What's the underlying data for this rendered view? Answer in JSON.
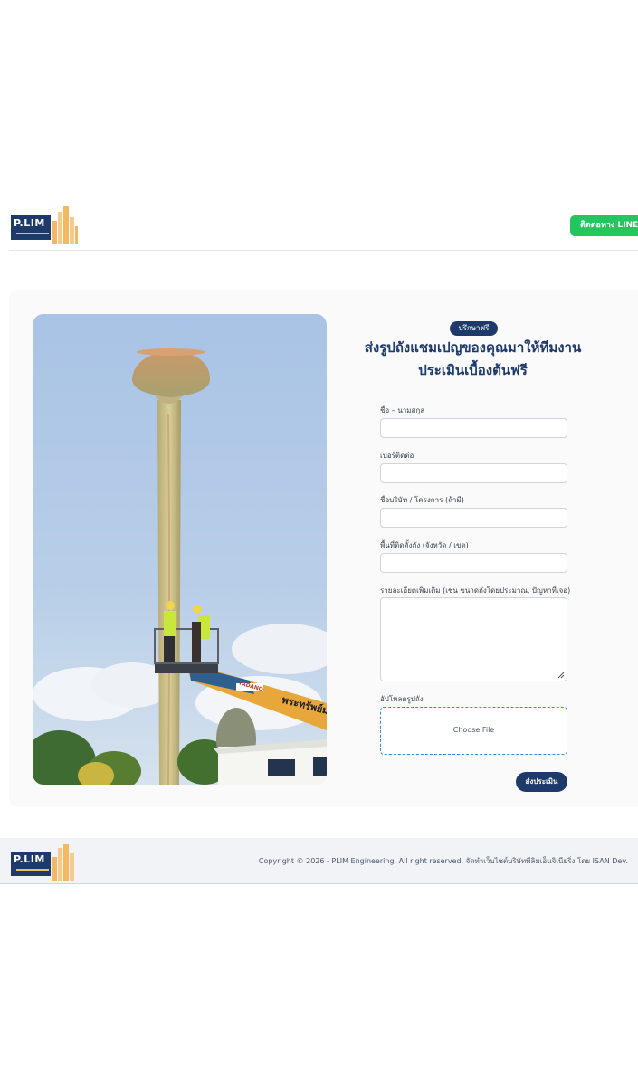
{
  "brand": {
    "logo_text": "P.LIM"
  },
  "header": {
    "line_button_label": "ติดต่อทาง LINE"
  },
  "form": {
    "badge": "ปรึกษาฟรี",
    "title_line1": "ส่งรูปถังแชมเปญของคุณมาให้ทีมงาน",
    "title_line2": "ประเมินเบื้องต้นฟรี",
    "fields": [
      {
        "label": "ชื่อ – นามสกุล",
        "value": ""
      },
      {
        "label": "เบอร์ติดต่อ",
        "value": ""
      },
      {
        "label": "ชื่อบริษัท / โครงการ (ถ้ามี)",
        "value": ""
      },
      {
        "label": "พื้นที่ติดตั้งถัง (จังหวัด / เขต)",
        "value": ""
      }
    ],
    "details_label": "รายละเอียดเพิ่มเติม (เช่น ขนาดถังโดยประมาณ, ปัญหาที่เจอ)",
    "upload_label": "อัปโหลดรูปถัง",
    "upload_button": "Choose File",
    "submit_label": "ส่งประเมิน"
  },
  "photo": {
    "truck_text": "พระทรัพย์ม",
    "boom_brand": "TADANO"
  },
  "footer": {
    "copyright": "Copyright © 2026 - PLIM Engineering. All right reserved. จัดทำเว็บไซต์บริษัทพีลิมเอ็นจิเนียริ่ง โดย ISAN Dev."
  },
  "colors": {
    "brand_navy": "#1e3a6b",
    "accent_gold": "#f4b860",
    "line_green": "#22c55e",
    "dropzone_border": "#3b82f6"
  }
}
